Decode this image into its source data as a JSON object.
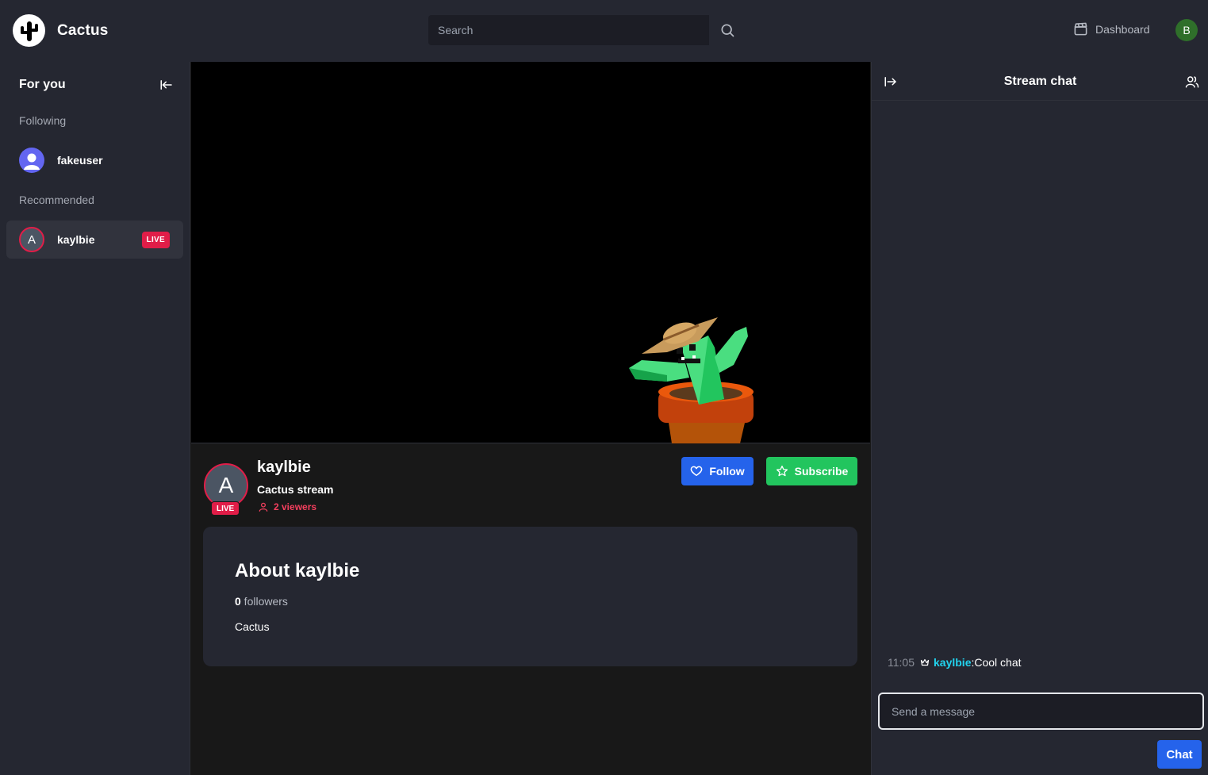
{
  "app": {
    "name": "Cactus"
  },
  "search": {
    "placeholder": "Search"
  },
  "nav": {
    "dashboard_label": "Dashboard",
    "user_initial": "B"
  },
  "sidebar": {
    "title": "For you",
    "following_label": "Following",
    "recommended_label": "Recommended",
    "following": [
      {
        "name": "fakeuser"
      }
    ],
    "recommended": [
      {
        "name": "kaylbie",
        "initial": "A",
        "badge": "LIVE"
      }
    ]
  },
  "stream": {
    "streamer": "kaylbie",
    "avatar_initial": "A",
    "live_badge": "LIVE",
    "title": "Cactus stream",
    "viewers": "2 viewers",
    "follow_label": "Follow",
    "subscribe_label": "Subscribe"
  },
  "about": {
    "title": "About kaylbie",
    "followers_count": "0",
    "followers_label": " followers",
    "bio": "Cactus"
  },
  "chat": {
    "title": "Stream chat",
    "messages": [
      {
        "time": "11:05",
        "user": "kaylbie",
        "separator": ": ",
        "text": "Cool chat"
      }
    ],
    "input_placeholder": "Send a message",
    "send_label": "Chat"
  },
  "colors": {
    "live": "#e11d48",
    "follow": "#2563eb",
    "subscribe": "#22c55e",
    "chat_user": "#22d3ee",
    "panel": "#252731"
  }
}
